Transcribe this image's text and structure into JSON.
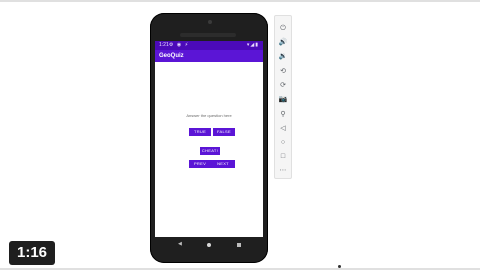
{
  "phone": {
    "status_time": "1:21",
    "status_icons_left": "⚙ ◉ ⚡",
    "status_icons_right": "▾◢▮",
    "app_title": "GeoQuiz",
    "question_text": "Answer the question here",
    "true_label": "TRUE",
    "false_label": "FALSE",
    "cheat_label": "CHEAT!",
    "prev_label": "PREV",
    "next_label": "NEXT",
    "nav_back": "◀",
    "accent_color": "#5b15d6",
    "statusbar_color": "#4b0ab8"
  },
  "toolbar": {
    "icons": [
      "power-icon",
      "volume-up-icon",
      "volume-down-icon",
      "rotate-left-icon",
      "rotate-right-icon",
      "camera-icon",
      "zoom-icon",
      "back-icon",
      "home-icon",
      "overview-icon",
      "more-icon"
    ],
    "glyphs": {
      "power": "⏻",
      "volume_up": "🔊",
      "volume_down": "🔉",
      "rotate_left": "⟲",
      "rotate_right": "⟳",
      "camera": "📷",
      "zoom": "⚲",
      "back": "◁",
      "home": "○",
      "overview": "□",
      "more": "⋯"
    }
  },
  "video": {
    "timestamp": "1:16"
  }
}
